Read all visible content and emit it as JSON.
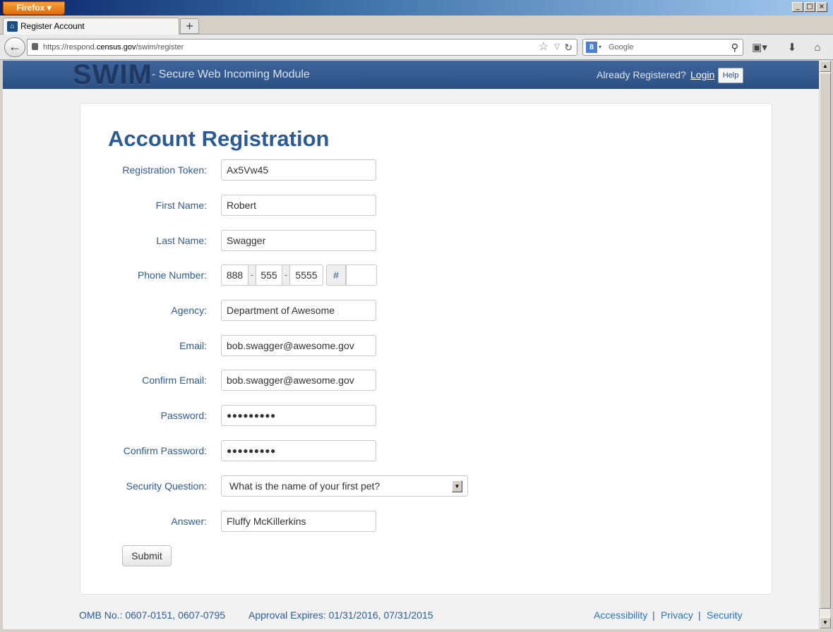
{
  "browser": {
    "menu_label": "Firefox",
    "tab_title": "Register Account",
    "new_tab": "+",
    "url_prefix": "https://respond.",
    "url_domain": "census.gov",
    "url_path": "/swim/register",
    "search_placeholder": "Google",
    "window_controls": [
      "_",
      "□",
      "×"
    ]
  },
  "header": {
    "logo": "SWIM",
    "tagline": "- Secure Web Incoming Module",
    "already_registered": "Already Registered?",
    "login": "Login",
    "help": "Help"
  },
  "form": {
    "title": "Account Registration",
    "fields": {
      "token": {
        "label": "Registration Token:",
        "value": "Ax5Vw45"
      },
      "first_name": {
        "label": "First Name:",
        "value": "Robert"
      },
      "last_name": {
        "label": "Last Name:",
        "value": "Swagger"
      },
      "phone": {
        "label": "Phone Number:",
        "area": "888",
        "prefix": "555",
        "line": "5555",
        "dash": "-",
        "ext_symbol": "#",
        "ext": ""
      },
      "agency": {
        "label": "Agency:",
        "value": "Department of Awesome"
      },
      "email": {
        "label": "Email:",
        "value": "bob.swagger@awesome.gov"
      },
      "confirm_email": {
        "label": "Confirm Email:",
        "value": "bob.swagger@awesome.gov"
      },
      "password": {
        "label": "Password:",
        "value": "●●●●●●●●●"
      },
      "confirm_password": {
        "label": "Confirm Password:",
        "value": "●●●●●●●●●"
      },
      "security_question": {
        "label": "Security Question:",
        "value": "What is the name of your first pet?"
      },
      "answer": {
        "label": "Answer:",
        "value": "Fluffy McKillerkins"
      }
    },
    "submit": "Submit"
  },
  "footer": {
    "omb": "OMB No.: 0607-0151, 0607-0795",
    "approval": "Approval Expires: 01/31/2016, 07/31/2015",
    "links": [
      "Accessibility",
      "Privacy",
      "Security"
    ],
    "separator": "|"
  }
}
